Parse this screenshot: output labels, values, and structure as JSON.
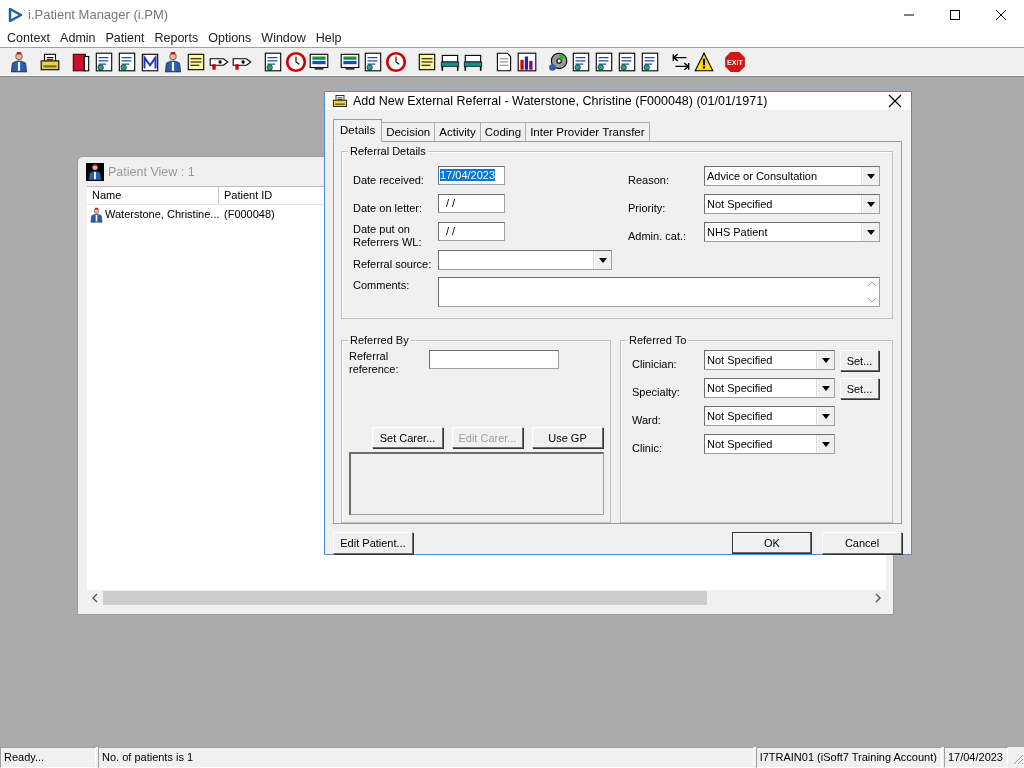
{
  "app": {
    "title": "i.Patient Manager (i.PM)",
    "menu": [
      "Context",
      "Admin",
      "Patient",
      "Reports",
      "Options",
      "Window",
      "Help"
    ],
    "toolbar": [
      [
        {
          "kind": "person"
        }
      ],
      [
        {
          "kind": "printer"
        }
      ],
      [
        {
          "kind": "book"
        },
        {
          "kind": "form"
        },
        {
          "kind": "form"
        },
        {
          "kind": "mail"
        },
        {
          "kind": "person"
        },
        {
          "kind": "note"
        },
        {
          "kind": "ticket"
        },
        {
          "kind": "ticket"
        }
      ],
      [
        {
          "kind": "form"
        },
        {
          "kind": "clock"
        },
        {
          "kind": "screen"
        }
      ],
      [
        {
          "kind": "screen"
        },
        {
          "kind": "form"
        },
        {
          "kind": "clock"
        }
      ],
      [
        {
          "kind": "note"
        },
        {
          "kind": "bed"
        },
        {
          "kind": "bed"
        }
      ],
      [
        {
          "kind": "page"
        },
        {
          "kind": "chart"
        }
      ],
      [
        {
          "kind": "disc"
        },
        {
          "kind": "form"
        },
        {
          "kind": "form"
        },
        {
          "kind": "form"
        },
        {
          "kind": "form"
        }
      ],
      [
        {
          "kind": "arrows"
        },
        {
          "kind": "warning"
        }
      ],
      [
        {
          "kind": "stop",
          "text": "EXIT"
        }
      ]
    ]
  },
  "patient_view": {
    "title": "Patient View : 1",
    "columns": [
      "Name",
      "Patient ID"
    ],
    "rows": [
      {
        "name": "Waterstone, Christine...",
        "patient_id": "(F000048)",
        "selected": false
      }
    ]
  },
  "dialog": {
    "title": "Add New External Referral - Waterstone, Christine (F000048) (01/01/1971)",
    "tabs": [
      {
        "label": "Details",
        "selected": true
      },
      {
        "label": "Decision",
        "selected": false
      },
      {
        "label": "Activity",
        "selected": false
      },
      {
        "label": "Coding",
        "selected": false
      },
      {
        "label": "Inter Provider Transfer",
        "selected": false
      }
    ],
    "referral_details": {
      "title": "Referral Details",
      "left": [
        {
          "label": "Date received:",
          "kind": "date",
          "value": "17/04/2023",
          "highlighted": true
        },
        {
          "label": "Date on letter:",
          "kind": "date",
          "value": "/ /",
          "highlighted": false
        },
        {
          "label": "Date put on Referrers WL:",
          "kind": "date",
          "value": "/ /",
          "highlighted": false
        },
        {
          "label": "Referral source:",
          "kind": "combo",
          "highlighted": false
        }
      ],
      "right": [
        {
          "label": "Reason:",
          "kind": "combo",
          "value": "Advice or Consultation",
          "highlighted": false
        },
        {
          "label": "Priority:",
          "kind": "combo",
          "value": "Not Specified",
          "highlighted": false
        },
        {
          "label": "Admin. cat.:",
          "kind": "combo",
          "value": "NHS Patient",
          "highlighted": false
        }
      ],
      "comments": {
        "label": "Comments:"
      }
    },
    "referred_by": {
      "title": "Referred By",
      "reference_label": "Referral reference:",
      "buttons": [
        {
          "label": "Set Carer...",
          "disabled": false
        },
        {
          "label": "Edit Carer...",
          "disabled": true
        },
        {
          "label": "Use GP",
          "disabled": false
        }
      ]
    },
    "referred_to": {
      "title": "Referred To",
      "fields": [
        {
          "label": "Clinician:",
          "value": "Not Specified",
          "set_button": "Set..."
        },
        {
          "label": "Specialty:",
          "value": "Not Specified",
          "set_button": "Set..."
        },
        {
          "label": "Ward:",
          "value": "Not Specified"
        },
        {
          "label": "Clinic:",
          "value": "Not Specified"
        }
      ]
    },
    "footer": {
      "left": [
        {
          "label": "Edit Patient...",
          "default": false
        }
      ],
      "right": [
        {
          "label": "OK",
          "default": true
        },
        {
          "label": "Cancel",
          "default": false
        }
      ]
    }
  },
  "status_bar": [
    "Ready...",
    "No. of patients is 1",
    "I7TRAIN01 (iSoft7 Training Account)",
    "17/04/2023"
  ]
}
